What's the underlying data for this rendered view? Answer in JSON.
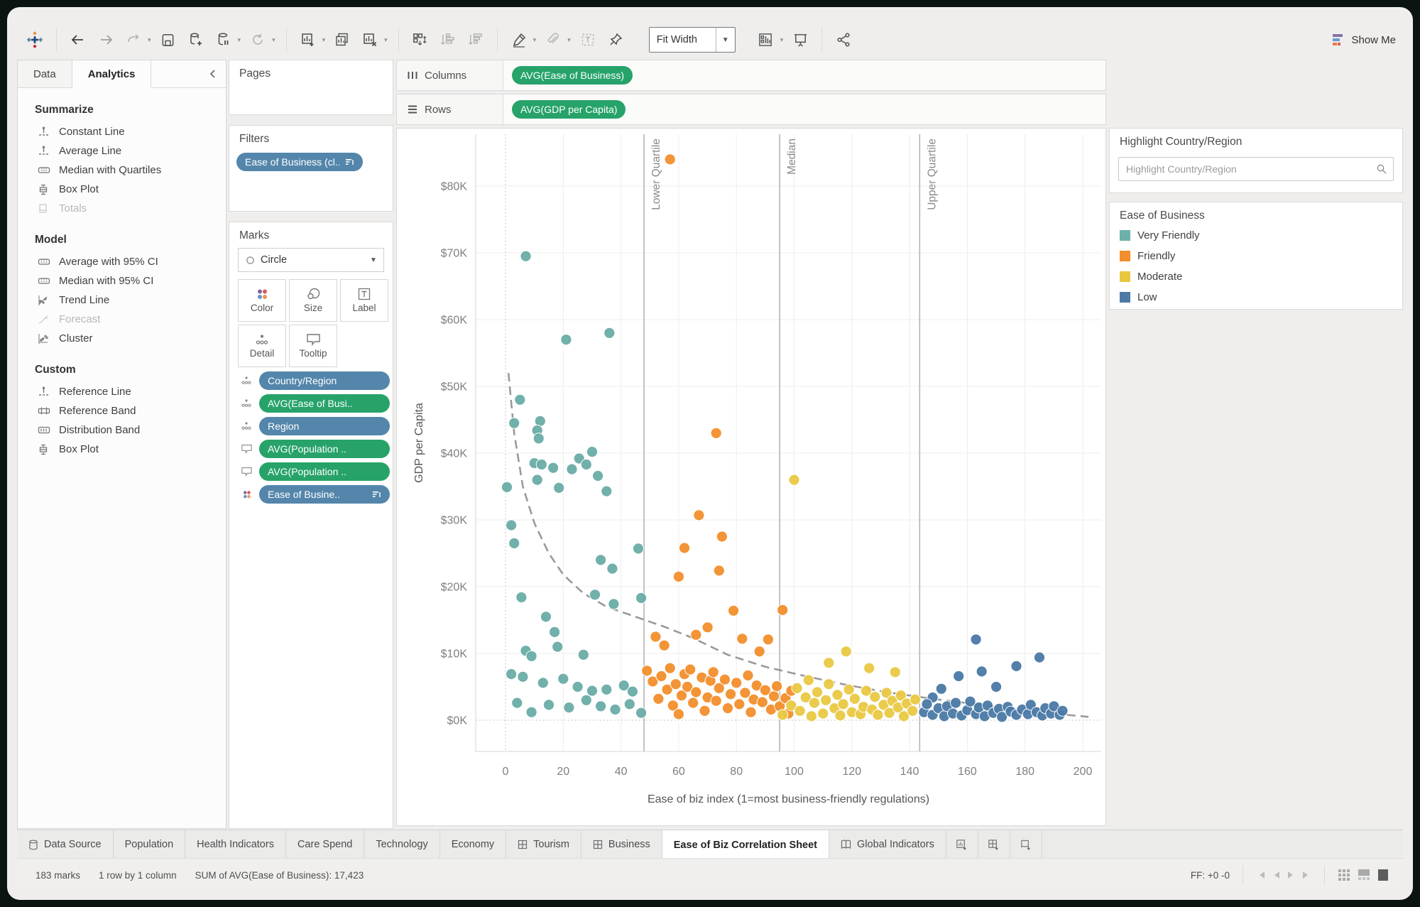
{
  "toolbar": {
    "fit_label": "Fit Width",
    "show_me": "Show Me"
  },
  "sidebar": {
    "tabs": [
      {
        "label": "Data"
      },
      {
        "label": "Analytics"
      }
    ],
    "sections": [
      {
        "title": "Summarize",
        "items": [
          {
            "label": "Constant Line"
          },
          {
            "label": "Average Line"
          },
          {
            "label": "Median with Quartiles"
          },
          {
            "label": "Box Plot"
          },
          {
            "label": "Totals",
            "disabled": true
          }
        ]
      },
      {
        "title": "Model",
        "items": [
          {
            "label": "Average with 95% CI"
          },
          {
            "label": "Median with 95% CI"
          },
          {
            "label": "Trend Line"
          },
          {
            "label": "Forecast",
            "disabled": true
          },
          {
            "label": "Cluster"
          }
        ]
      },
      {
        "title": "Custom",
        "items": [
          {
            "label": "Reference Line"
          },
          {
            "label": "Reference Band"
          },
          {
            "label": "Distribution Band"
          },
          {
            "label": "Box Plot"
          }
        ]
      }
    ]
  },
  "cards": {
    "pages_title": "Pages",
    "filters_title": "Filters",
    "filters_pill": "Ease of Business (cl..",
    "marks_title": "Marks",
    "mark_type": "Circle",
    "buttons": [
      {
        "label": "Color"
      },
      {
        "label": "Size"
      },
      {
        "label": "Label"
      },
      {
        "label": "Detail"
      },
      {
        "label": "Tooltip"
      }
    ],
    "pills": [
      {
        "label": "Country/Region",
        "color": "blue",
        "icon": "detail"
      },
      {
        "label": "AVG(Ease of Busi..",
        "color": "green",
        "icon": "detail"
      },
      {
        "label": "Region",
        "color": "blue",
        "icon": "detail"
      },
      {
        "label": "AVG(Population ..",
        "color": "green",
        "icon": "tooltip"
      },
      {
        "label": "AVG(Population ..",
        "color": "green",
        "icon": "tooltip"
      },
      {
        "label": "Ease of Busine..",
        "color": "blue",
        "icon": "color",
        "sorted": true
      }
    ]
  },
  "shelves": {
    "columns_label": "Columns",
    "columns_pill": "AVG(Ease of Business)",
    "rows_label": "Rows",
    "rows_pill": "AVG(GDP per Capita)"
  },
  "right_panel": {
    "highlight_title": "Highlight Country/Region",
    "search_placeholder": "Highlight Country/Region",
    "legend_title": "Ease of Business",
    "legend_items": [
      {
        "label": "Very Friendly",
        "color": "#6cb0aa"
      },
      {
        "label": "Friendly",
        "color": "#f28e2b"
      },
      {
        "label": "Moderate",
        "color": "#e9c63f"
      },
      {
        "label": "Low",
        "color": "#4e79a7"
      }
    ]
  },
  "sheet_tabs": [
    {
      "label": "Data Source",
      "icon": "database"
    },
    {
      "label": "Population"
    },
    {
      "label": "Health Indicators"
    },
    {
      "label": "Care Spend"
    },
    {
      "label": "Technology"
    },
    {
      "label": "Economy"
    },
    {
      "label": "Tourism",
      "icon": "grid"
    },
    {
      "label": "Business",
      "icon": "grid"
    },
    {
      "label": "Ease of Biz Correlation Sheet",
      "active": true
    },
    {
      "label": "Global Indicators",
      "icon": "dashboard"
    }
  ],
  "status_bar": {
    "marks": "183 marks",
    "rows_cols": "1 row by 1 column",
    "sum": "SUM of AVG(Ease of Business): 17,423",
    "ff": "FF: +0 -0"
  },
  "chart_data": {
    "type": "scatter",
    "xlabel": "Ease of biz index (1=most business-friendly regulations)",
    "ylabel": "GDP per Capita",
    "xlim": [
      -11,
      206
    ],
    "ylim": [
      0,
      88
    ],
    "x_ticks": [
      0,
      20,
      40,
      60,
      80,
      100,
      120,
      140,
      160,
      180,
      200
    ],
    "y_ticks": [
      0,
      10,
      20,
      30,
      40,
      50,
      60,
      70,
      80
    ],
    "y_tick_labels": [
      "$0K",
      "$10K",
      "$20K",
      "$30K",
      "$40K",
      "$50K",
      "$60K",
      "$70K",
      "$80K"
    ],
    "grid": true,
    "legend_position": "right",
    "reference_lines": [
      {
        "x": 48,
        "label": "Lower Quartile"
      },
      {
        "x": 95,
        "label": "Median"
      },
      {
        "x": 143.5,
        "label": "Upper Quartile"
      }
    ],
    "trend_line": [
      [
        1,
        52
      ],
      [
        3,
        43
      ],
      [
        6,
        35
      ],
      [
        10,
        29.5
      ],
      [
        15,
        25
      ],
      [
        20,
        21.8
      ],
      [
        27,
        19
      ],
      [
        35,
        17
      ],
      [
        45,
        15.5
      ],
      [
        55,
        14
      ],
      [
        65,
        12.3
      ],
      [
        77,
        9.8
      ],
      [
        90,
        8
      ],
      [
        104,
        6.6
      ],
      [
        118,
        5.3
      ],
      [
        132,
        4.2
      ],
      [
        148,
        3.2
      ],
      [
        165,
        2.3
      ],
      [
        182,
        1.3
      ],
      [
        202,
        0.5
      ]
    ],
    "series": [
      {
        "name": "Very Friendly",
        "color": "#69aca6",
        "points": [
          [
            7,
            69.5
          ],
          [
            21,
            57
          ],
          [
            36,
            58
          ],
          [
            5,
            48
          ],
          [
            3,
            44.5
          ],
          [
            12,
            44.8
          ],
          [
            11,
            43.4
          ],
          [
            11.5,
            42.2
          ],
          [
            10,
            38.5
          ],
          [
            12.5,
            38.3
          ],
          [
            16.5,
            37.8
          ],
          [
            23,
            37.6
          ],
          [
            25.5,
            39.2
          ],
          [
            28,
            38.3
          ],
          [
            30,
            40.2
          ],
          [
            32,
            36.6
          ],
          [
            11,
            36
          ],
          [
            18.5,
            34.8
          ],
          [
            0.5,
            34.9
          ],
          [
            35,
            34.3
          ],
          [
            2,
            29.2
          ],
          [
            3,
            26.5
          ],
          [
            46,
            25.7
          ],
          [
            33,
            24
          ],
          [
            37,
            22.7
          ],
          [
            5.5,
            18.4
          ],
          [
            31,
            18.8
          ],
          [
            37.5,
            17.4
          ],
          [
            47,
            18.3
          ],
          [
            14,
            15.5
          ],
          [
            17,
            13.2
          ],
          [
            7,
            10.4
          ],
          [
            9,
            9.6
          ],
          [
            18,
            11
          ],
          [
            27,
            9.8
          ],
          [
            2,
            6.9
          ],
          [
            6,
            6.5
          ],
          [
            13,
            5.6
          ],
          [
            20,
            6.2
          ],
          [
            25,
            5
          ],
          [
            30,
            4.4
          ],
          [
            35,
            4.6
          ],
          [
            41,
            5.2
          ],
          [
            44,
            4.3
          ],
          [
            4,
            2.6
          ],
          [
            9,
            1.2
          ],
          [
            15,
            2.3
          ],
          [
            22,
            1.9
          ],
          [
            28,
            3
          ],
          [
            33,
            2.1
          ],
          [
            38,
            1.6
          ],
          [
            43,
            2.4
          ],
          [
            47,
            1.1
          ]
        ]
      },
      {
        "name": "Friendly",
        "color": "#f28e2b",
        "points": [
          [
            57,
            84
          ],
          [
            73,
            43
          ],
          [
            67,
            30.7
          ],
          [
            75,
            27.5
          ],
          [
            62,
            25.8
          ],
          [
            74,
            22.4
          ],
          [
            60,
            21.5
          ],
          [
            79,
            16.4
          ],
          [
            70,
            13.9
          ],
          [
            52,
            12.5
          ],
          [
            55,
            11.2
          ],
          [
            66,
            12.8
          ],
          [
            82,
            12.2
          ],
          [
            91,
            12.1
          ],
          [
            96,
            16.5
          ],
          [
            88,
            10.3
          ],
          [
            49,
            7.4
          ],
          [
            51,
            5.8
          ],
          [
            53,
            3.2
          ],
          [
            54,
            6.6
          ],
          [
            56,
            4.6
          ],
          [
            57,
            7.8
          ],
          [
            58,
            2.2
          ],
          [
            59,
            5.4
          ],
          [
            60,
            0.9
          ],
          [
            61,
            3.7
          ],
          [
            62,
            6.9
          ],
          [
            63,
            5
          ],
          [
            64,
            7.6
          ],
          [
            65,
            2.6
          ],
          [
            66,
            4.2
          ],
          [
            68,
            6.4
          ],
          [
            69,
            1.4
          ],
          [
            70,
            3.4
          ],
          [
            71,
            5.9
          ],
          [
            72,
            7.2
          ],
          [
            73,
            2.9
          ],
          [
            74,
            4.8
          ],
          [
            76,
            6.1
          ],
          [
            77,
            1.8
          ],
          [
            78,
            3.9
          ],
          [
            80,
            5.6
          ],
          [
            81,
            2.4
          ],
          [
            83,
            4.1
          ],
          [
            84,
            6.7
          ],
          [
            85,
            1.2
          ],
          [
            86,
            3.1
          ],
          [
            87,
            5.2
          ],
          [
            89,
            2.7
          ],
          [
            90,
            4.5
          ],
          [
            92,
            1.6
          ],
          [
            93,
            3.6
          ],
          [
            94,
            5.1
          ],
          [
            95,
            2.1
          ],
          [
            97,
            3.3
          ],
          [
            98,
            1
          ],
          [
            99,
            4.4
          ]
        ]
      },
      {
        "name": "Moderate",
        "color": "#e9c842",
        "points": [
          [
            100,
            36
          ],
          [
            118,
            10.3
          ],
          [
            112,
            8.6
          ],
          [
            126,
            7.8
          ],
          [
            135,
            7.2
          ],
          [
            96,
            0.8
          ],
          [
            99,
            2.2
          ],
          [
            101,
            4.8
          ],
          [
            102,
            1.4
          ],
          [
            104,
            3.4
          ],
          [
            105,
            6
          ],
          [
            106,
            0.6
          ],
          [
            107,
            2.6
          ],
          [
            108,
            4.2
          ],
          [
            110,
            1
          ],
          [
            111,
            3
          ],
          [
            112,
            5.4
          ],
          [
            114,
            1.8
          ],
          [
            115,
            3.8
          ],
          [
            116,
            0.7
          ],
          [
            117,
            2.4
          ],
          [
            119,
            4.6
          ],
          [
            120,
            1.2
          ],
          [
            121,
            3.2
          ],
          [
            123,
            0.9
          ],
          [
            124,
            2
          ],
          [
            125,
            4.4
          ],
          [
            127,
            1.6
          ],
          [
            128,
            3.5
          ],
          [
            129,
            0.8
          ],
          [
            131,
            2.3
          ],
          [
            132,
            4.1
          ],
          [
            133,
            1.1
          ],
          [
            134,
            2.9
          ],
          [
            136,
            1.9
          ],
          [
            137,
            3.7
          ],
          [
            138,
            0.6
          ],
          [
            139,
            2.5
          ],
          [
            141,
            1.4
          ],
          [
            142,
            3.1
          ]
        ]
      },
      {
        "name": "Low",
        "color": "#4a79a5",
        "points": [
          [
            163,
            12.1
          ],
          [
            185,
            9.4
          ],
          [
            177,
            8.1
          ],
          [
            157,
            6.6
          ],
          [
            165,
            7.3
          ],
          [
            170,
            5
          ],
          [
            151,
            4.7
          ],
          [
            148,
            3.4
          ],
          [
            145,
            1.2
          ],
          [
            146,
            2.4
          ],
          [
            148,
            0.8
          ],
          [
            150,
            1.8
          ],
          [
            152,
            0.6
          ],
          [
            153,
            2.1
          ],
          [
            155,
            1
          ],
          [
            156,
            2.6
          ],
          [
            158,
            0.7
          ],
          [
            160,
            1.5
          ],
          [
            161,
            2.8
          ],
          [
            163,
            0.9
          ],
          [
            164,
            1.9
          ],
          [
            166,
            0.6
          ],
          [
            167,
            2.2
          ],
          [
            169,
            1.1
          ],
          [
            171,
            1.7
          ],
          [
            172,
            0.5
          ],
          [
            174,
            2
          ],
          [
            175,
            1.3
          ],
          [
            177,
            0.8
          ],
          [
            179,
            1.6
          ],
          [
            181,
            0.9
          ],
          [
            182,
            2.3
          ],
          [
            184,
            1.2
          ],
          [
            186,
            0.7
          ],
          [
            187,
            1.8
          ],
          [
            189,
            1
          ],
          [
            190,
            2.1
          ],
          [
            192,
            0.8
          ],
          [
            193,
            1.4
          ]
        ]
      }
    ]
  }
}
